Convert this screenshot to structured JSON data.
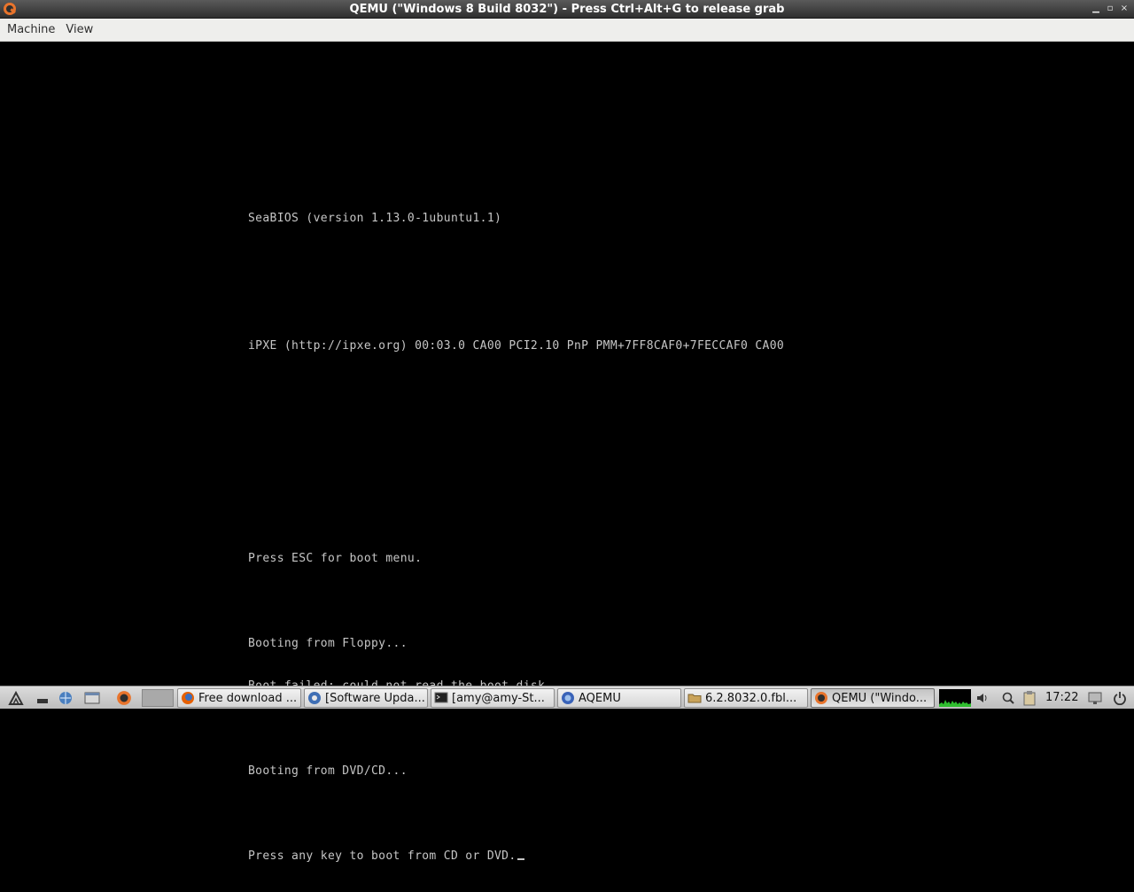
{
  "window": {
    "title": "QEMU (\"Windows 8 Build 8032\") - Press Ctrl+Alt+G to release grab",
    "app_icon": "qemu-icon",
    "controls": {
      "minimize": "minimize-icon",
      "maximize": "maximize-icon",
      "close": "close-icon"
    }
  },
  "menubar": {
    "items": [
      {
        "label": "Machine"
      },
      {
        "label": "View"
      }
    ]
  },
  "bios": {
    "lines": [
      "SeaBIOS (version 1.13.0-1ubuntu1.1)",
      "",
      "",
      "iPXE (http://ipxe.org) 00:03.0 CA00 PCI2.10 PnP PMM+7FF8CAF0+7FECCAF0 CA00",
      "",
      "",
      "",
      "",
      "Press ESC for boot menu.",
      "",
      "Booting from Floppy...",
      "Boot failed: could not read the boot disk",
      "",
      "Booting from DVD/CD...",
      "",
      "Press any key to boot from CD or DVD."
    ],
    "text_color": "#c6c6c6",
    "background": "#000000"
  },
  "taskbar": {
    "launchers": [
      {
        "icon": "menu-icon"
      },
      {
        "icon": "show-desktop-icon"
      },
      {
        "icon": "browser-icon"
      },
      {
        "icon": "file-manager-icon"
      },
      {
        "icon": "qemu-launcher-icon"
      }
    ],
    "tasks": [
      {
        "icon": "firefox-icon",
        "label": "Free download ..."
      },
      {
        "icon": "software-update-icon",
        "label": "[Software Upda..."
      },
      {
        "icon": "terminal-icon",
        "label": "[amy@amy-St..."
      },
      {
        "icon": "aqemu-icon",
        "label": "AQEMU"
      },
      {
        "icon": "folder-icon",
        "label": "6.2.8032.0.fbl..."
      },
      {
        "icon": "qemu-icon",
        "label": "QEMU (\"Windo...",
        "active": true
      }
    ],
    "tray": {
      "icons": [
        "cpu-monitor",
        "volume-icon",
        "search-icon",
        "clipboard-icon"
      ],
      "clock": "17:22",
      "end_icons": [
        "screen-lock-icon",
        "power-icon"
      ]
    }
  }
}
